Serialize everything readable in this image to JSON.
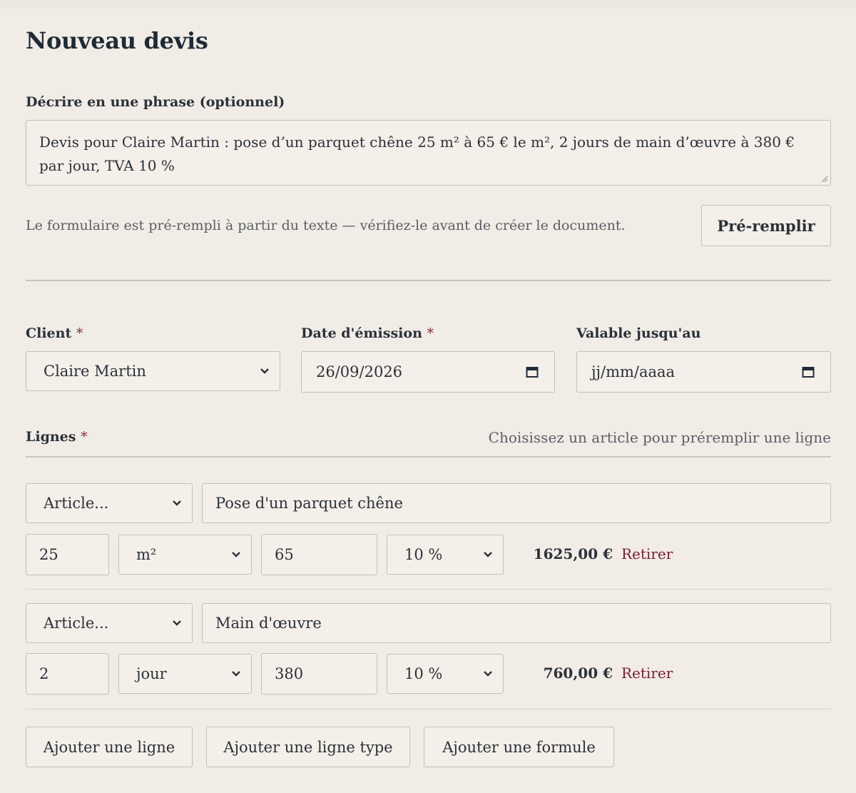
{
  "page": {
    "title": "Nouveau devis"
  },
  "description": {
    "label": "Décrire en une phrase (optionnel)",
    "value": "Devis pour Claire Martin : pose d’un parquet chêne 25 m² à 65 € le m², 2 jours de main d’œuvre à 380 € par jour, TVA 10 %",
    "hint": "Le formulaire est pré-rempli à partir du texte — vérifiez-le avant de créer le document.",
    "prefill_button": "Pré-remplir"
  },
  "form": {
    "client": {
      "label": "Client",
      "required_mark": "*",
      "value": "Claire Martin"
    },
    "issue_date": {
      "label": "Date d'émission",
      "required_mark": "*",
      "value": "26/09/2026"
    },
    "valid_until": {
      "label": "Valable jusqu'au",
      "placeholder": "jj/mm/aaaa"
    }
  },
  "lines": {
    "label": "Lignes",
    "required_mark": "*",
    "hint": "Choisissez un article pour préremplir une ligne",
    "items": [
      {
        "article": "Article...",
        "designation": "Pose d'un parquet chêne",
        "quantity": "25",
        "unit": "m²",
        "price": "65",
        "vat": "10 %",
        "total": "1625,00 €",
        "remove": "Retirer"
      },
      {
        "article": "Article...",
        "designation": "Main d'œuvre",
        "quantity": "2",
        "unit": "jour",
        "price": "380",
        "vat": "10 %",
        "total": "760,00 €",
        "remove": "Retirer"
      }
    ],
    "actions": {
      "add_line": "Ajouter une ligne",
      "add_line_type": "Ajouter une ligne type",
      "add_formula": "Ajouter une formule"
    }
  },
  "colors": {
    "background": "#f1ece6",
    "text": "#2b3138",
    "accent": "#7a1e2e",
    "border": "#c3bfba"
  },
  "icons": {
    "select": "chevron-down-icon",
    "date": "calendar-icon",
    "resize": "resize-grip-icon"
  }
}
